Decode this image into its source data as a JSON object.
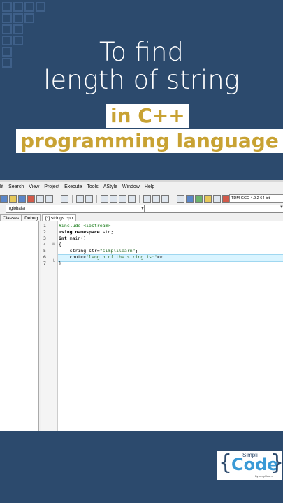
{
  "hero": {
    "line1": "To find",
    "line2": "length of string",
    "highlight1": "in C++",
    "highlight2": "programming language"
  },
  "ide": {
    "menu": [
      "lit",
      "Search",
      "View",
      "Project",
      "Execute",
      "Tools",
      "AStyle",
      "Window",
      "Help"
    ],
    "compiler": "TDM-GCC 4.9.2 64-bit",
    "scope": "(globals)",
    "left_tabs": [
      "Classes",
      "Debug"
    ],
    "file_tab": "[*] strings.cpp",
    "line_numbers": [
      "1",
      "2",
      "3",
      "4",
      "5",
      "6",
      "7"
    ],
    "code": {
      "l1": "#include <iostream>",
      "l2a": "using namespace",
      "l2b": " std;",
      "l3a": "int",
      "l3b": " main()",
      "l4": "{",
      "l5a": "    string str=",
      "l5b": "\"simplilearn\"",
      "l5c": ";",
      "l6a": "    cout<<",
      "l6b": "\"length of the string is:\"",
      "l6c": "<<",
      "l7": "}"
    }
  },
  "brand": {
    "small": "Simpli",
    "big": "Code",
    "by": "By simplilearn",
    "open_brace": "{",
    "close_brace": "}"
  },
  "colors": {
    "background": "#2c4a6d",
    "highlight_text": "#c8a233",
    "brand_blue": "#3a9ad6"
  }
}
